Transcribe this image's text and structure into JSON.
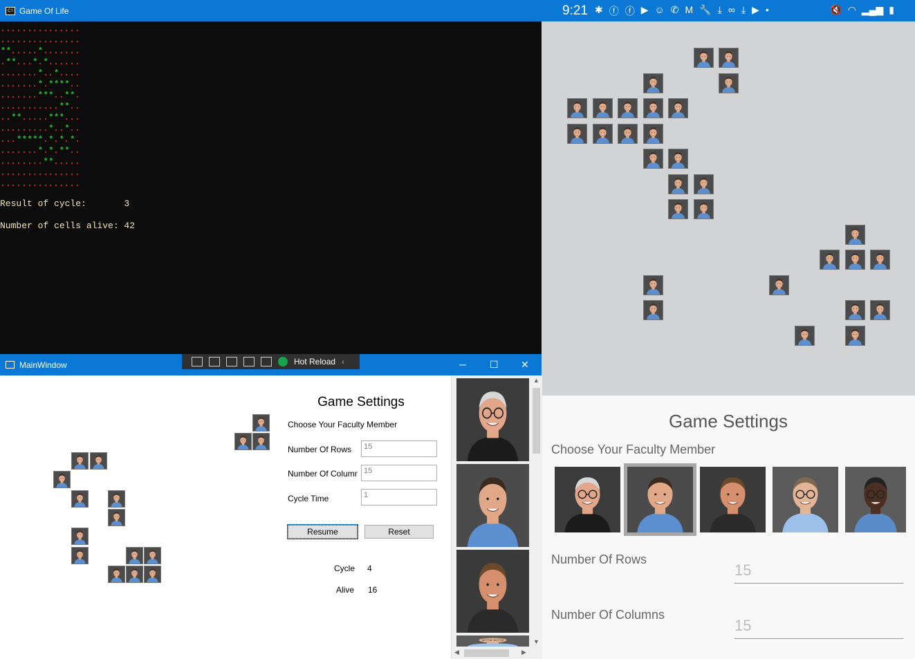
{
  "console": {
    "title": "Game Of Life",
    "cycle_line": "Result of cycle:       3",
    "alive_line": "Number of cells alive: 42",
    "colors": {
      "dead": "#d61f1f",
      "alive": "#22c51a",
      "text": "#f1e7b4"
    }
  },
  "phone": {
    "time": "9:21",
    "settings_title": "Game Settings",
    "choose_label": "Choose Your Faculty Member",
    "rows_label": "Number Of Rows",
    "rows_value": "15",
    "cols_label": "Number Of Columns",
    "cols_value": "15",
    "faculty_count": 5,
    "selected_faculty": 2
  },
  "main_window": {
    "title": "MainWindow",
    "hot_reload": "Hot Reload",
    "settings_title": "Game Settings",
    "choose_label": "Choose Your Faculty Member",
    "rows_label": "Number Of Rows",
    "rows_value": "15",
    "cols_label": "Number Of Columns",
    "cols_value": "15",
    "cycle_time_label": "Cycle Time",
    "cycle_time_value": "1",
    "resume_button": "Resume",
    "reset_button": "Reset",
    "cycle_label": "Cycle",
    "cycle_value": "4",
    "alive_label": "Alive",
    "alive_value": "16"
  }
}
